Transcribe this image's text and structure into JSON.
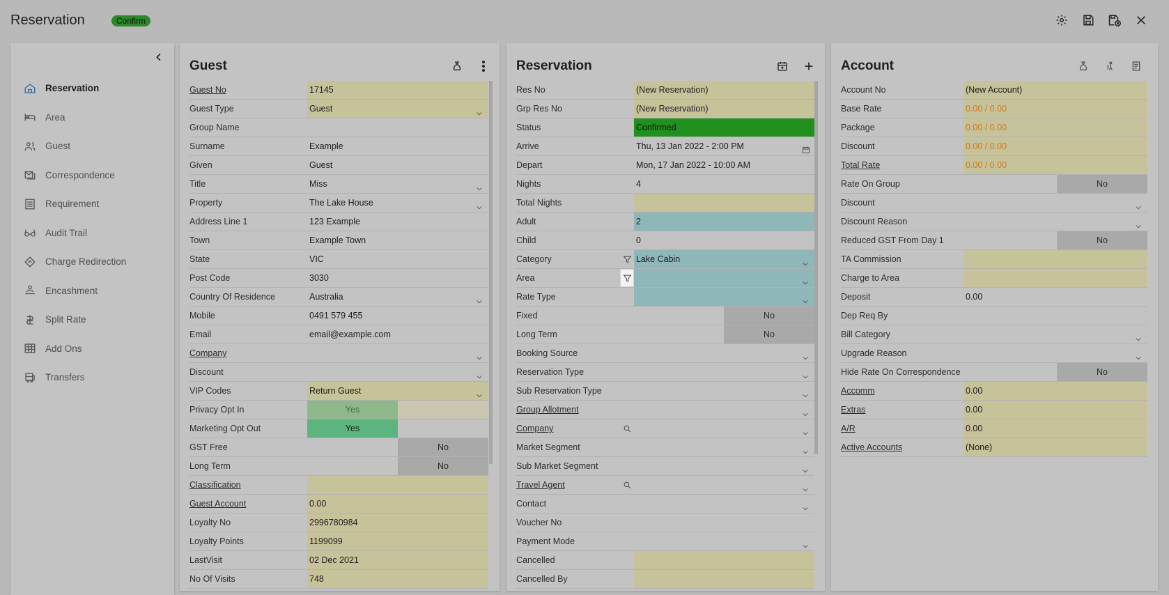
{
  "header": {
    "title": "Reservation",
    "status_chip": "Confirm",
    "icons": [
      "gear-icon",
      "save-icon",
      "save-close-icon",
      "close-icon"
    ]
  },
  "sidebar": {
    "items": [
      {
        "label": "Reservation",
        "icon": "home-icon",
        "active": true
      },
      {
        "label": "Area",
        "icon": "bed-icon"
      },
      {
        "label": "Guest",
        "icon": "users-icon"
      },
      {
        "label": "Correspondence",
        "icon": "mail-icon"
      },
      {
        "label": "Requirement",
        "icon": "list-icon"
      },
      {
        "label": "Audit Trail",
        "icon": "glasses-icon"
      },
      {
        "label": "Charge Redirection",
        "icon": "diamond-arrow-icon"
      },
      {
        "label": "Encashment",
        "icon": "hand-cash-icon"
      },
      {
        "label": "Split Rate",
        "icon": "split-icon"
      },
      {
        "label": "Add Ons",
        "icon": "grid-icon"
      },
      {
        "label": "Transfers",
        "icon": "bus-icon"
      }
    ]
  },
  "guest": {
    "title": "Guest",
    "rows": [
      {
        "label": "Guest No",
        "value": "17145",
        "fill": "y",
        "link": true
      },
      {
        "label": "Guest Type",
        "value": "Guest",
        "fill": "y",
        "dropdown": true
      },
      {
        "label": "Group Name",
        "value": ""
      },
      {
        "label": "Surname",
        "value": "Example"
      },
      {
        "label": "Given",
        "value": "Guest"
      },
      {
        "label": "Title",
        "value": "Miss",
        "dropdown": true
      },
      {
        "label": "Property",
        "value": "The Lake House",
        "dropdown": true
      },
      {
        "label": "Address Line 1",
        "value": "123 Example"
      },
      {
        "label": "Town",
        "value": "Example Town"
      },
      {
        "label": "State",
        "value": "VIC"
      },
      {
        "label": "Post Code",
        "value": "3030"
      },
      {
        "label": "Country Of Residence",
        "value": "Australia",
        "dropdown": true
      },
      {
        "label": "Mobile",
        "value": "0491 579 455"
      },
      {
        "label": "Email",
        "value": "email@example.com"
      },
      {
        "label": "Company",
        "value": "",
        "link": true,
        "dropdown": true
      },
      {
        "label": "Discount",
        "value": "",
        "dropdown": true
      },
      {
        "label": "VIP Codes",
        "value": "Return Guest",
        "fill": "y",
        "dropdown": true
      },
      {
        "label": "Privacy Opt In",
        "toggle": "Yes",
        "toggleStyle": "yes-light",
        "rest": "grey"
      },
      {
        "label": "Marketing Opt Out",
        "toggle": "Yes",
        "toggleStyle": "yes-dark"
      },
      {
        "label": "GST Free",
        "toggleRight": "No"
      },
      {
        "label": "Long Term",
        "toggleRight": "No"
      },
      {
        "label": "Classification",
        "value": "",
        "fill": "y",
        "link": true
      },
      {
        "label": "Guest Account",
        "value": "0.00",
        "fill": "y",
        "link": true
      },
      {
        "label": "Loyalty No",
        "value": "2996780984",
        "fill": "y"
      },
      {
        "label": "Loyalty Points",
        "value": "1199099",
        "fill": "y"
      },
      {
        "label": "LastVisit",
        "value": "02 Dec 2021",
        "fill": "y"
      },
      {
        "label": "No Of Visits",
        "value": "748",
        "fill": "y"
      }
    ]
  },
  "reservation": {
    "title": "Reservation",
    "rows": [
      {
        "label": "Res No",
        "value": "(New Reservation)",
        "fill": "y"
      },
      {
        "label": "Grp Res No",
        "value": "(New Reservation)",
        "fill": "y"
      },
      {
        "label": "Status",
        "value": "Confirmed",
        "fill": "g"
      },
      {
        "label": "Arrive",
        "value": "Thu, 13 Jan 2022 - 2:00 PM",
        "calendar": true
      },
      {
        "label": "Depart",
        "value": "Mon, 17 Jan 2022 - 10:00 AM"
      },
      {
        "label": "Nights",
        "value": "4"
      },
      {
        "label": "Total Nights",
        "value": "",
        "fill": "y"
      },
      {
        "label": "Adult",
        "value": "2",
        "fill": "t"
      },
      {
        "label": "Child",
        "value": "0"
      },
      {
        "label": "Category",
        "value": "Lake Cabin",
        "fill": "t",
        "dropdown": true,
        "filter": true
      },
      {
        "label": "Area",
        "value": "",
        "fill": "t",
        "dropdown": true,
        "filter": true,
        "filterBoxed": true
      },
      {
        "label": "Rate Type",
        "value": "",
        "fill": "t",
        "dropdown": true
      },
      {
        "label": "Fixed",
        "toggleRight": "No"
      },
      {
        "label": "Long Term",
        "toggleRight": "No"
      },
      {
        "label": "Booking Source",
        "value": "",
        "dropdown": true
      },
      {
        "label": "Reservation Type",
        "value": "",
        "dropdown": true
      },
      {
        "label": "Sub Reservation Type",
        "value": "",
        "dropdown": true
      },
      {
        "label": "Group Allotment",
        "value": "",
        "dropdown": true,
        "link": true
      },
      {
        "label": "Company",
        "value": "",
        "dropdown": true,
        "link": true,
        "search": true
      },
      {
        "label": "Market Segment",
        "value": "",
        "dropdown": true
      },
      {
        "label": "Sub Market Segment",
        "value": "",
        "dropdown": true
      },
      {
        "label": "Travel Agent",
        "value": "",
        "dropdown": true,
        "link": true,
        "search": true
      },
      {
        "label": "Contact",
        "value": "",
        "dropdown": true
      },
      {
        "label": "Voucher No",
        "value": ""
      },
      {
        "label": "Payment Mode",
        "value": "",
        "dropdown": true
      },
      {
        "label": "Cancelled",
        "value": "",
        "fill": "y"
      },
      {
        "label": "Cancelled By",
        "value": "",
        "fill": "y"
      }
    ]
  },
  "account": {
    "title": "Account",
    "rows": [
      {
        "label": "Account No",
        "value": "(New Account)",
        "fill": "y"
      },
      {
        "label": "Base Rate",
        "value": "0.00 / 0.00",
        "fill": "y",
        "orange": true
      },
      {
        "label": "Package",
        "value": "0.00 / 0.00",
        "fill": "y",
        "orange": true
      },
      {
        "label": "Discount",
        "value": "0.00 / 0.00",
        "fill": "y",
        "orange": true
      },
      {
        "label": "Total Rate",
        "value": "0.00 / 0.00",
        "fill": "y",
        "orange": true,
        "link": true
      },
      {
        "label": "Rate On Group",
        "toggleRight": "No"
      },
      {
        "label": "Discount",
        "value": "",
        "dropdown": true
      },
      {
        "label": "Discount Reason",
        "value": "",
        "dropdown": true
      },
      {
        "label": "Reduced GST From Day 1",
        "toggleRight": "No"
      },
      {
        "label": "TA Commission",
        "value": "",
        "fill": "y"
      },
      {
        "label": "Charge to Area",
        "value": "",
        "fill": "y"
      },
      {
        "label": "Deposit",
        "value": "0.00"
      },
      {
        "label": "Dep Req By",
        "value": ""
      },
      {
        "label": "Bill Category",
        "value": "",
        "dropdown": true
      },
      {
        "label": "Upgrade Reason",
        "value": "",
        "dropdown": true
      },
      {
        "label": "Hide Rate On Correspondence",
        "toggleRight": "No"
      },
      {
        "label": "Accomm",
        "value": "0.00",
        "fill": "y",
        "link": true
      },
      {
        "label": "Extras",
        "value": "0.00",
        "fill": "y",
        "link": true
      },
      {
        "label": "A/R",
        "value": "0.00",
        "fill": "y",
        "link": true
      },
      {
        "label": "Active Accounts",
        "value": "(None)",
        "fill": "y",
        "link": true
      }
    ]
  }
}
